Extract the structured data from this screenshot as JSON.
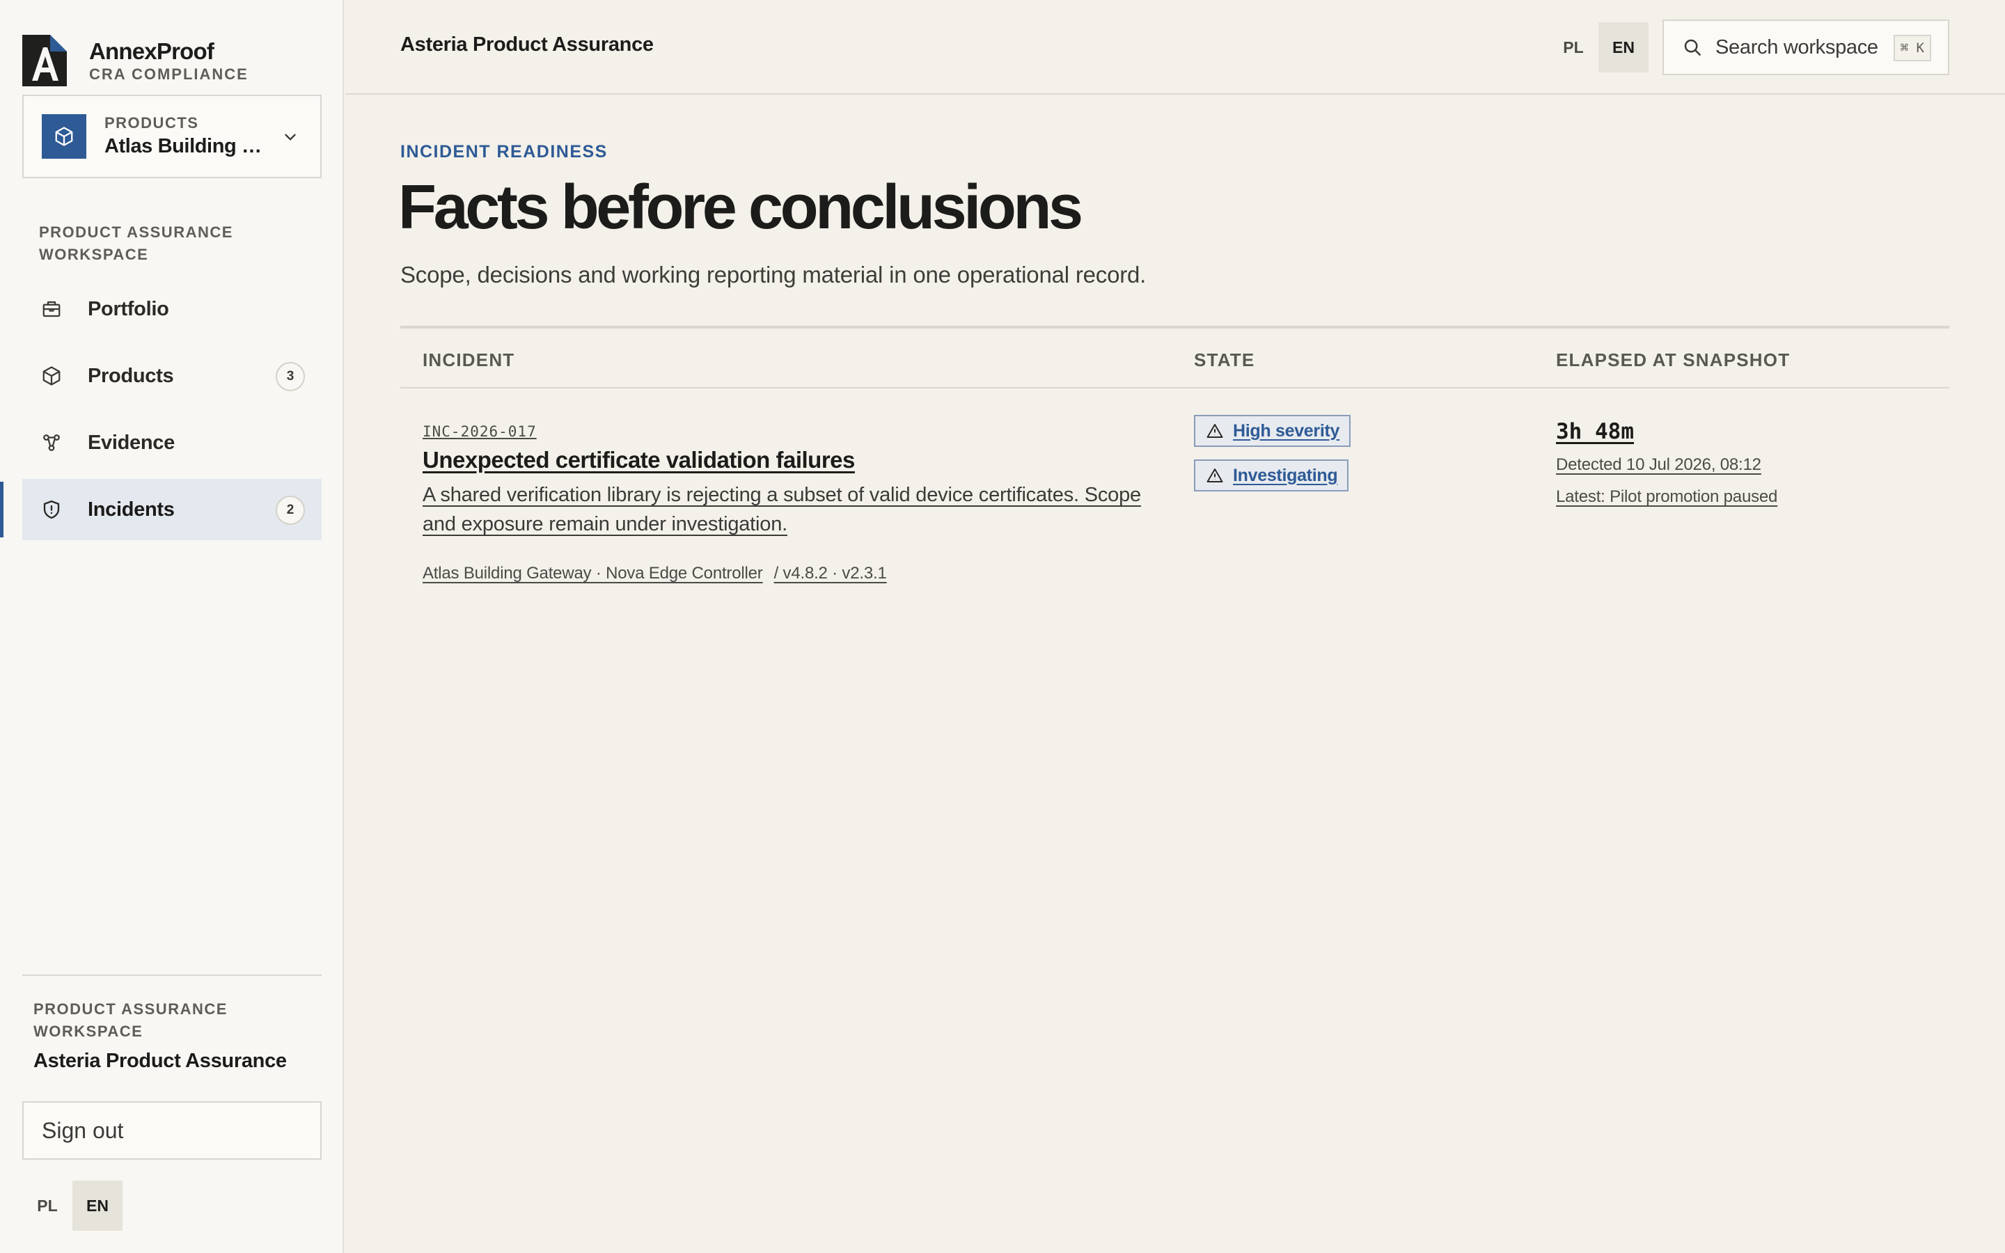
{
  "brand": {
    "name": "AnnexProof",
    "subtitle": "CRA COMPLIANCE"
  },
  "product_picker": {
    "label": "PRODUCTS",
    "value": "Atlas Building Gateway"
  },
  "sidebar": {
    "heading": "PRODUCT ASSURANCE WORKSPACE",
    "items": [
      {
        "label": "Portfolio",
        "icon": "briefcase-icon",
        "count": null,
        "active": false
      },
      {
        "label": "Products",
        "icon": "cube-icon",
        "count": "3",
        "active": false
      },
      {
        "label": "Evidence",
        "icon": "graph-nodes-icon",
        "count": null,
        "active": false
      },
      {
        "label": "Incidents",
        "icon": "shield-alert-icon",
        "count": "2",
        "active": true
      }
    ],
    "footer": {
      "heading": "PRODUCT ASSURANCE WORKSPACE",
      "workspace": "Asteria Product Assurance",
      "sign_out": "Sign out",
      "languages": [
        "PL",
        "EN"
      ],
      "active_language": "EN"
    }
  },
  "topbar": {
    "title": "Asteria Product Assurance",
    "languages": [
      "PL",
      "EN"
    ],
    "active_language": "EN",
    "search_placeholder": "Search workspace",
    "search_shortcut": "⌘ K"
  },
  "page": {
    "eyebrow": "INCIDENT READINESS",
    "title": "Facts before conclusions",
    "subtitle": "Scope, decisions and working reporting material in one operational record."
  },
  "table": {
    "columns": [
      "INCIDENT",
      "STATE",
      "ELAPSED AT SNAPSHOT"
    ],
    "rows": [
      {
        "id": "INC-2026-017",
        "title": "Unexpected certificate validation failures",
        "description": "A shared verification library is rejecting a subset of valid device certificates. Scope and exposure remain under investigation.",
        "products": "Atlas Building Gateway · Nova Edge Controller",
        "versions": "/ v4.8.2 · v2.3.1",
        "badges": [
          "High severity",
          "Investigating"
        ],
        "elapsed": "3h 48m",
        "detected": "Detected 10 Jul 2026, 08:12",
        "latest": "Latest: Pilot promotion paused"
      }
    ]
  },
  "colors": {
    "accent": "#2e5a96",
    "background": "#f3f1ea",
    "sidebar": "#f8f7f3",
    "active_nav": "#e4e8ef"
  }
}
